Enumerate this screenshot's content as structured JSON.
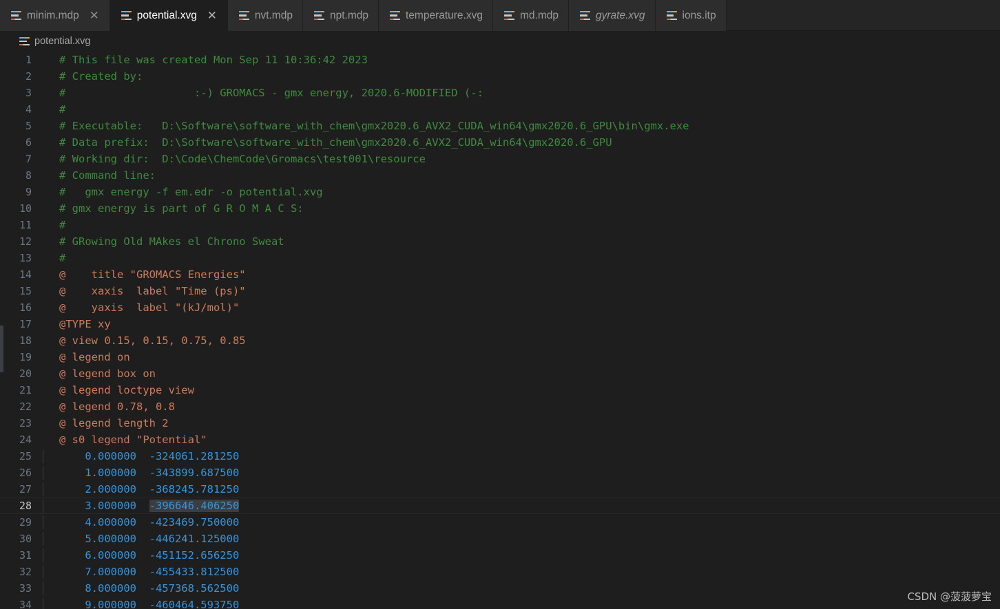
{
  "colors": {
    "editor_bg": "#1e1e1e",
    "tabbar_bg": "#252526",
    "tab_inactive_bg": "#2d2d2d",
    "comment_green": "#3f8a3f",
    "directive_orange": "#ce7b5c",
    "number_blue": "#3794dc",
    "selection_gray": "#3a3d41",
    "linenumber_gray": "#6e7681"
  },
  "tabs": [
    {
      "label": "minim.mdp",
      "icon": "config-file-icon",
      "active": false,
      "preview": false,
      "closable": true
    },
    {
      "label": "potential.xvg",
      "icon": "config-file-icon",
      "active": true,
      "preview": false,
      "closable": true
    },
    {
      "label": "nvt.mdp",
      "icon": "config-file-icon",
      "active": false,
      "preview": false,
      "closable": false
    },
    {
      "label": "npt.mdp",
      "icon": "config-file-icon",
      "active": false,
      "preview": false,
      "closable": false
    },
    {
      "label": "temperature.xvg",
      "icon": "config-file-icon",
      "active": false,
      "preview": false,
      "closable": false
    },
    {
      "label": "md.mdp",
      "icon": "config-file-icon",
      "active": false,
      "preview": false,
      "closable": false
    },
    {
      "label": "gyrate.xvg",
      "icon": "config-file-icon",
      "active": false,
      "preview": true,
      "closable": false
    },
    {
      "label": "ions.itp",
      "icon": "config-file-icon",
      "active": false,
      "preview": false,
      "closable": false
    }
  ],
  "tab_close_glyph": "✕",
  "breadcrumb": {
    "icon": "config-file-icon",
    "label": "potential.xvg"
  },
  "editor": {
    "active_line": 28,
    "lines": [
      {
        "n": 1,
        "cls": "c-comment",
        "text": "# This file was created Mon Sep 11 10:36:42 2023"
      },
      {
        "n": 2,
        "cls": "c-comment",
        "text": "# Created by:"
      },
      {
        "n": 3,
        "cls": "c-comment",
        "text": "#                    :-) GROMACS - gmx energy, 2020.6-MODIFIED (-:"
      },
      {
        "n": 4,
        "cls": "c-comment",
        "text": "#"
      },
      {
        "n": 5,
        "cls": "c-comment",
        "text": "# Executable:   D:\\Software\\software_with_chem\\gmx2020.6_AVX2_CUDA_win64\\gmx2020.6_GPU\\bin\\gmx.exe"
      },
      {
        "n": 6,
        "cls": "c-comment",
        "text": "# Data prefix:  D:\\Software\\software_with_chem\\gmx2020.6_AVX2_CUDA_win64\\gmx2020.6_GPU"
      },
      {
        "n": 7,
        "cls": "c-comment",
        "text": "# Working dir:  D:\\Code\\ChemCode\\Gromacs\\test001\\resource"
      },
      {
        "n": 8,
        "cls": "c-comment",
        "text": "# Command line:"
      },
      {
        "n": 9,
        "cls": "c-comment",
        "text": "#   gmx energy -f em.edr -o potential.xvg"
      },
      {
        "n": 10,
        "cls": "c-comment",
        "text": "# gmx energy is part of G R O M A C S:"
      },
      {
        "n": 11,
        "cls": "c-comment",
        "text": "#"
      },
      {
        "n": 12,
        "cls": "c-comment",
        "text": "# GRowing Old MAkes el Chrono Sweat"
      },
      {
        "n": 13,
        "cls": "c-comment",
        "text": "#"
      },
      {
        "n": 14,
        "cls": "c-at",
        "text": "@    title \"GROMACS Energies\""
      },
      {
        "n": 15,
        "cls": "c-at",
        "text": "@    xaxis  label \"Time (ps)\""
      },
      {
        "n": 16,
        "cls": "c-at",
        "text": "@    yaxis  label \"(kJ/mol)\""
      },
      {
        "n": 17,
        "cls": "c-at",
        "text": "@TYPE xy"
      },
      {
        "n": 18,
        "cls": "c-at",
        "text": "@ view 0.15, 0.15, 0.75, 0.85"
      },
      {
        "n": 19,
        "cls": "c-at",
        "text": "@ legend on"
      },
      {
        "n": 20,
        "cls": "c-at",
        "text": "@ legend box on"
      },
      {
        "n": 21,
        "cls": "c-at",
        "text": "@ legend loctype view"
      },
      {
        "n": 22,
        "cls": "c-at",
        "text": "@ legend 0.78, 0.8"
      },
      {
        "n": 23,
        "cls": "c-at",
        "text": "@ legend length 2"
      },
      {
        "n": 24,
        "cls": "c-at",
        "text": "@ s0 legend \"Potential\""
      },
      {
        "n": 25,
        "cls": "c-num",
        "guide": true,
        "text": "    0.000000  -324061.281250"
      },
      {
        "n": 26,
        "cls": "c-num",
        "guide": true,
        "text": "    1.000000  -343899.687500"
      },
      {
        "n": 27,
        "cls": "c-num",
        "guide": true,
        "text": "    2.000000  -368245.781250"
      },
      {
        "n": 28,
        "cls": "c-num",
        "guide": true,
        "text": "    3.000000  ",
        "highlight": "-396646.406250"
      },
      {
        "n": 29,
        "cls": "c-num",
        "guide": true,
        "text": "    4.000000  -423469.750000"
      },
      {
        "n": 30,
        "cls": "c-num",
        "guide": true,
        "text": "    5.000000  -446241.125000"
      },
      {
        "n": 31,
        "cls": "c-num",
        "guide": true,
        "text": "    6.000000  -451152.656250"
      },
      {
        "n": 32,
        "cls": "c-num",
        "guide": true,
        "text": "    7.000000  -455433.812500"
      },
      {
        "n": 33,
        "cls": "c-num",
        "guide": true,
        "text": "    8.000000  -457368.562500"
      },
      {
        "n": 34,
        "cls": "c-num",
        "guide": true,
        "text": "    9.000000  -460464.593750"
      }
    ]
  },
  "watermark": "CSDN @菠菠萝宝"
}
